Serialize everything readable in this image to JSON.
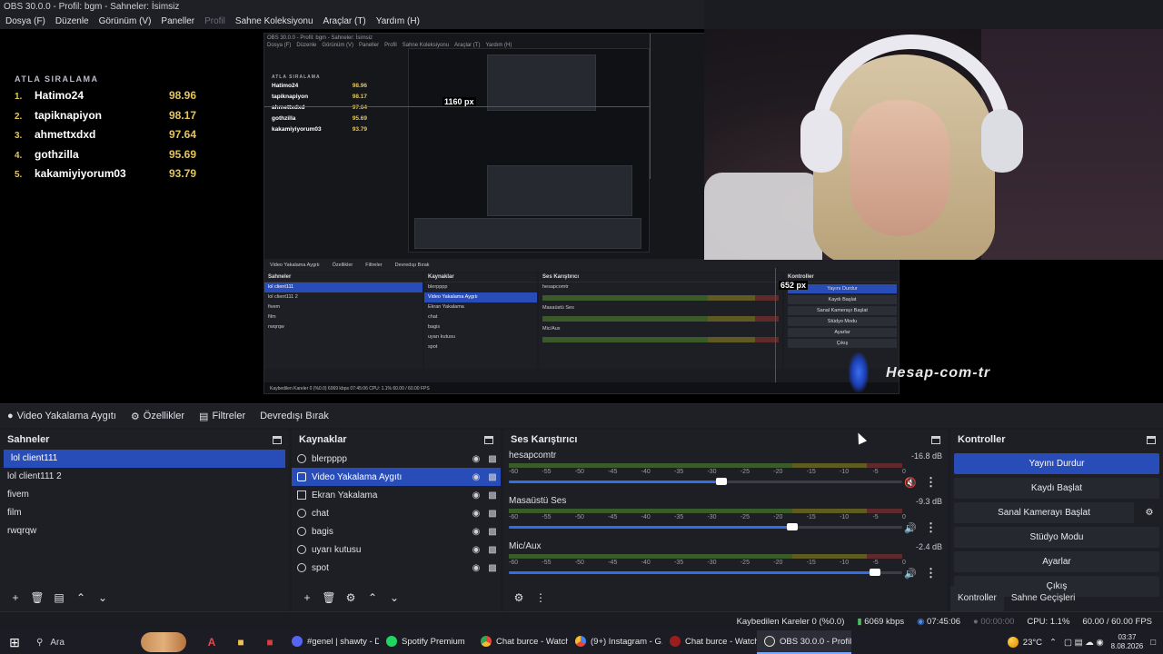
{
  "window": {
    "title": "OBS 30.0.0 - Profil: bgm - Sahneler: İsimsiz"
  },
  "menu": [
    "Dosya (F)",
    "Düzenle",
    "Görünüm (V)",
    "Paneller",
    "Profil",
    "Sahne Koleksiyonu",
    "Araçlar (T)",
    "Yardım (H)"
  ],
  "preview": {
    "leaderboard": {
      "title": "ATLA SIRALAMA",
      "rows": [
        {
          "rank": "1.",
          "name": "Hatimo24",
          "score": "98.96"
        },
        {
          "rank": "2.",
          "name": "tapiknapiyon",
          "score": "98.17"
        },
        {
          "rank": "3.",
          "name": "ahmettxdxd",
          "score": "97.64"
        },
        {
          "rank": "4.",
          "name": "gothzilla",
          "score": "95.69"
        },
        {
          "rank": "5.",
          "name": "kakamiyiyorum03",
          "score": "93.79"
        }
      ]
    },
    "measure_1": "1160 px",
    "measure_2": "652 px",
    "watermark": "Hesap-com-tr",
    "nested": {
      "title": "OBS 30.0.0 - Profil: bgm - Sahneler: İsimsiz",
      "menu": [
        "Dosya (F)",
        "Düzenle",
        "Görünüm (V)",
        "Paneller",
        "Profil",
        "Sahne Koleksiyonu",
        "Araçlar (T)",
        "Yardım (H)"
      ],
      "toolbar": [
        "Video Yakalama Aygıtı",
        "Özellikler",
        "Filtreler",
        "Devredışı Bırak"
      ],
      "scenes": [
        "lol client111",
        "lol client111 2",
        "fivem",
        "film",
        "rwqrqw"
      ],
      "sources": [
        "blerpppp",
        "Video Yakalama Aygıtı",
        "Ekran Yakalama",
        "chat",
        "bagis",
        "uyarı kutusu",
        "spot"
      ],
      "channels": [
        "hesapcomtr",
        "Masaüstü Ses",
        "Mic/Aux"
      ],
      "controls": [
        "Yayını Durdur",
        "Kaydı Başlat",
        "Sanal Kamerayı Başlat",
        "Stüdyo Modu",
        "Ayarlar",
        "Çıkış"
      ],
      "status": "Kaybedilen Kareler 0 (%0.0)   6069 kbps   07:45:06   CPU: 1.1%   60.00 / 60.00 FPS",
      "headers": {
        "scenes": "Sahneler",
        "sources": "Kaynaklar",
        "mixer": "Ses Karıştırıcı",
        "controls": "Kontroller"
      }
    }
  },
  "source_toolbar": {
    "source_name": "Video Yakalama Aygıtı",
    "properties": "Özellikler",
    "filters": "Filtreler",
    "disable": "Devredışı Bırak"
  },
  "scenes": {
    "title": "Sahneler",
    "items": [
      "lol client111",
      "lol client111 2",
      "fivem",
      "film",
      "rwqrqw"
    ],
    "selected_index": 0
  },
  "sources": {
    "title": "Kaynaklar",
    "items": [
      {
        "name": "blerpppp",
        "icon": "browser-icon"
      },
      {
        "name": "Video Yakalama Aygıtı",
        "icon": "camera-icon"
      },
      {
        "name": "Ekran Yakalama",
        "icon": "monitor-icon"
      },
      {
        "name": "chat",
        "icon": "browser-icon"
      },
      {
        "name": "bagis",
        "icon": "browser-icon"
      },
      {
        "name": "uyarı kutusu",
        "icon": "browser-icon"
      },
      {
        "name": "spot",
        "icon": "browser-icon"
      }
    ],
    "selected_index": 1
  },
  "mixer": {
    "title": "Ses Karıştırıcı",
    "ticks": [
      "-60",
      "-55",
      "-50",
      "-45",
      "-40",
      "-35",
      "-30",
      "-25",
      "-20",
      "-15",
      "-10",
      "-5",
      "0"
    ],
    "channels": [
      {
        "name": "hesapcomtr",
        "db": "-16.8 dB",
        "volume": 0.54,
        "muted": true
      },
      {
        "name": "Masaüstü Ses",
        "db": "-9.3 dB",
        "volume": 0.72,
        "muted": false
      },
      {
        "name": "Mic/Aux",
        "db": "-2.4 dB",
        "volume": 0.93,
        "muted": false
      }
    ]
  },
  "controls": {
    "title": "Kontroller",
    "stop_stream": "Yayını Durdur",
    "start_record": "Kaydı Başlat",
    "start_virtualcam": "Sanal Kamerayı Başlat",
    "studio_mode": "Stüdyo Modu",
    "settings": "Ayarlar",
    "exit": "Çıkış",
    "tabs": [
      "Kontroller",
      "Sahne Geçişleri"
    ]
  },
  "status": {
    "dropped": "Kaybedilen Kareler 0 (%0.0)",
    "bitrate": "6069 kbps",
    "stream_time": "07:45:06",
    "record_time": "00:00:00",
    "cpu": "CPU: 1.1%",
    "fps": "60.00 / 60.00 FPS"
  },
  "taskbar": {
    "search": "Ara",
    "apps": [
      {
        "label": "#genel | shawty - D...",
        "color": "#5865f2"
      },
      {
        "label": "Spotify Premium",
        "color": "#1ed760"
      },
      {
        "label": "Chat burce - Watch...",
        "color": "#e8453c"
      },
      {
        "label": "(9+) Instagram - G...",
        "color": "#4285f4"
      },
      {
        "label": "Chat burce - Watch...",
        "color": "#9c1d1d"
      },
      {
        "label": "OBS 30.0.0 - Profil:...",
        "color": "#3a3a3a"
      }
    ],
    "temperature": "23°C",
    "time": "03:37",
    "date": "8.08.2026"
  }
}
